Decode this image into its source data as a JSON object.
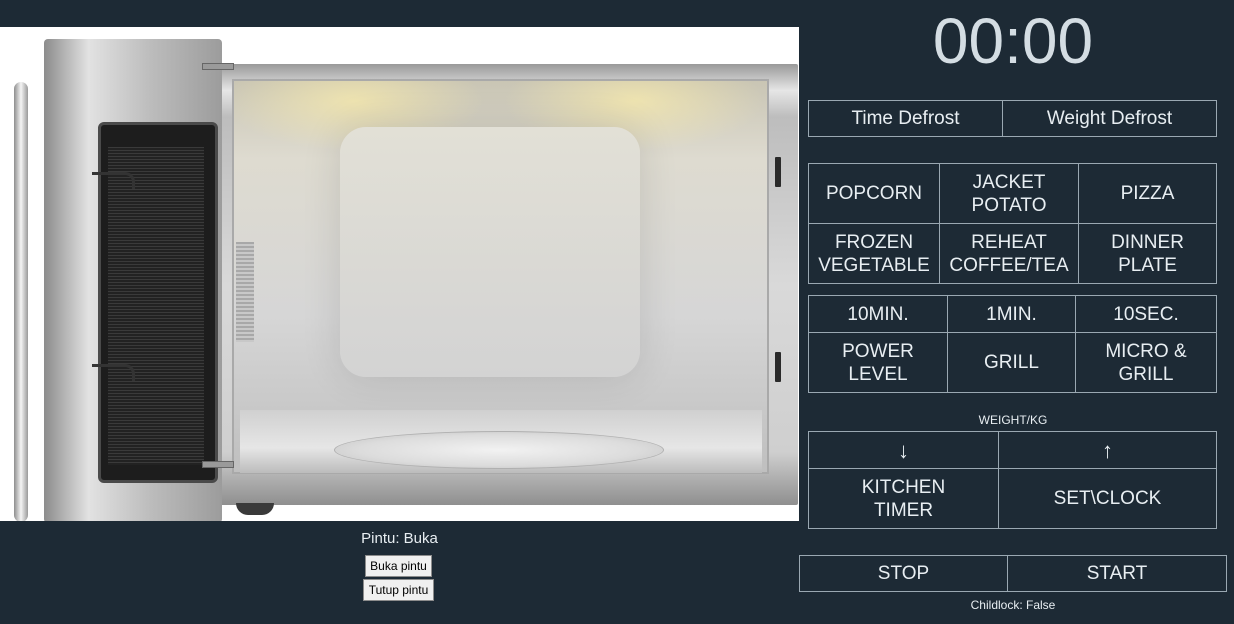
{
  "display": {
    "time": "00:00"
  },
  "defrost": {
    "time_defrost": "Time Defrost",
    "weight_defrost": "Weight Defrost"
  },
  "presets": [
    {
      "label": "POPCORN"
    },
    {
      "label": "JACKET\nPOTATO"
    },
    {
      "label": "PIZZA"
    },
    {
      "label": "FROZEN\nVEGETABLE"
    },
    {
      "label": "REHEAT\nCOFFEE/TEA"
    },
    {
      "label": "DINNER\nPLATE"
    }
  ],
  "time_keys": {
    "ten_min": "10MIN.",
    "one_min": "1MIN.",
    "ten_sec": "10SEC."
  },
  "modes": {
    "power_level": "POWER\nLEVEL",
    "grill": "GRILL",
    "micro_grill": "MICRO &\nGRILL"
  },
  "weight": {
    "label": "WEIGHT/KG",
    "down": "↓",
    "up": "↑"
  },
  "extras": {
    "kitchen_timer": "KITCHEN\nTIMER",
    "set_clock": "SET\\CLOCK"
  },
  "actions": {
    "stop": "STOP",
    "start": "START"
  },
  "childlock": {
    "text": "Childlock: False"
  },
  "door": {
    "status": "Pintu: Buka",
    "open_label": "Buka pintu",
    "close_label": "Tutup pintu"
  }
}
